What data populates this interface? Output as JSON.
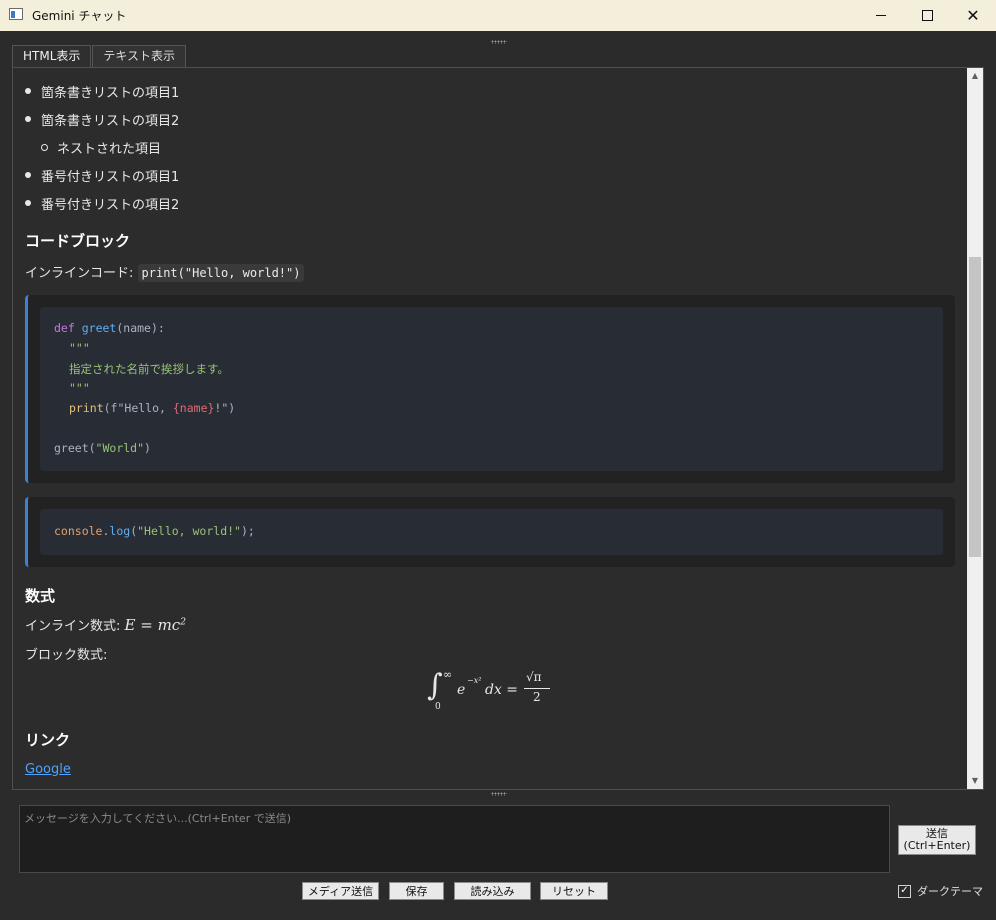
{
  "window": {
    "title": "Gemini チャット",
    "close_glyph": "✕"
  },
  "tabs": [
    {
      "label": "HTML表示",
      "active": true
    },
    {
      "label": "テキスト表示",
      "active": false
    }
  ],
  "content": {
    "list_items": [
      {
        "text": "箇条書きリストの項目1",
        "level": 1
      },
      {
        "text": "箇条書きリストの項目2",
        "level": 1
      },
      {
        "text": "ネストされた項目",
        "level": 2
      },
      {
        "text": "番号付きリストの項目1",
        "level": 1
      },
      {
        "text": "番号付きリストの項目2",
        "level": 1
      }
    ],
    "code_heading": "コードブロック",
    "inline_code_label": "インラインコード:",
    "inline_code": "print(\"Hello, world!\")",
    "python_code": {
      "line1_kw": "def",
      "line1_fn": "greet",
      "line1_rest": "(name):",
      "line2": "\"\"\"",
      "line3": "指定された名前で挨拶します。",
      "line4": "\"\"\"",
      "line5_builtin": "print",
      "line5_a": "(f\"Hello, ",
      "line5_interp": "{name}",
      "line5_b": "!\")",
      "line6_fn": "greet(",
      "line6_str": "\"World\"",
      "line6_end": ")"
    },
    "js_code": {
      "obj": "console",
      "dot": ".",
      "method": "log",
      "open": "(",
      "str": "\"Hello, world!\"",
      "close": ");"
    },
    "math_heading": "数式",
    "inline_math_label": "インライン数式:",
    "inline_math": "E = mc",
    "inline_math_sup": "2",
    "block_math_label": "ブロック数式:",
    "block_math": {
      "integral": "∫",
      "upper": "∞",
      "lower": "0",
      "base": "e",
      "exp": "−x²",
      "dx": "dx =",
      "num": "√π",
      "den": "2"
    },
    "link_heading": "リンク",
    "link_text": "Google"
  },
  "input": {
    "placeholder": "メッセージを入力してください...(Ctrl+Enter で送信)"
  },
  "buttons": {
    "send_line1": "送信",
    "send_line2": "(Ctrl+Enter)",
    "media": "メディア送信",
    "save": "保存",
    "load": "読み込み",
    "reset": "リセット"
  },
  "dark_theme": {
    "label": "ダークテーマ",
    "checked_glyph": "✓"
  }
}
